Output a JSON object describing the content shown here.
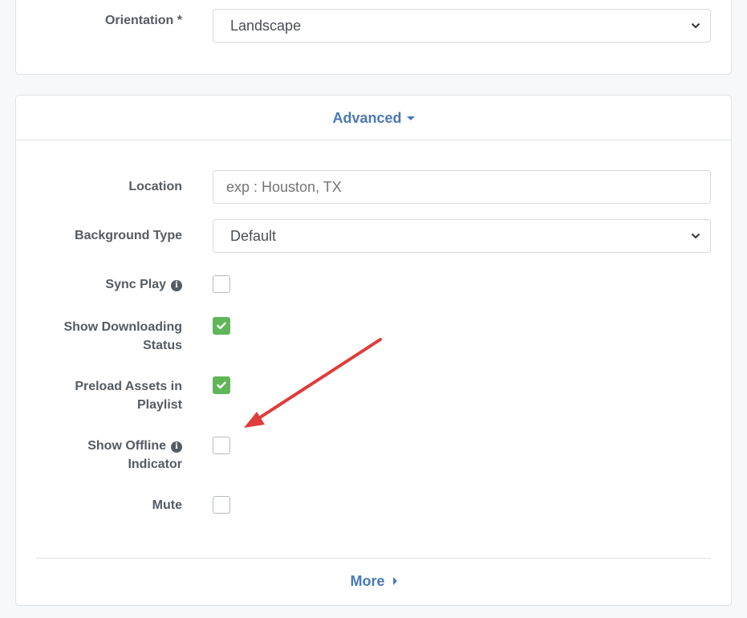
{
  "orientation": {
    "label": "Orientation *",
    "value": "Landscape"
  },
  "advanced": {
    "toggle_label": "Advanced",
    "location": {
      "label": "Location",
      "placeholder": "exp : Houston, TX",
      "value": ""
    },
    "background_type": {
      "label": "Background Type",
      "value": "Default"
    },
    "sync_play": {
      "label": "Sync Play",
      "checked": false,
      "info_icon": "info-icon"
    },
    "show_downloading_status": {
      "label_line1": "Show Downloading",
      "label_line2": "Status",
      "checked": true
    },
    "preload_assets": {
      "label_line1": "Preload Assets in",
      "label_line2": "Playlist",
      "checked": true
    },
    "show_offline_indicator": {
      "label_line1": "Show Offline",
      "label_line2": "Indicator",
      "checked": false,
      "info_icon": "info-icon"
    },
    "mute": {
      "label": "Mute",
      "checked": false
    },
    "more_label": "More"
  },
  "colors": {
    "accent": "#4b78b5",
    "check_green": "#5fb657",
    "annotation_arrow": "#e03c3c"
  }
}
